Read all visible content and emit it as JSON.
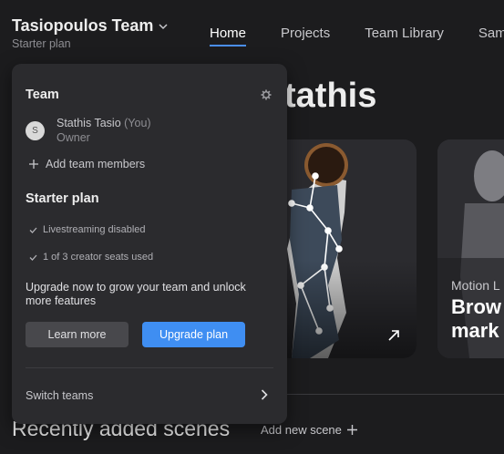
{
  "header": {
    "team_name": "Tasiopoulos Team",
    "plan_label": "Starter plan"
  },
  "nav": {
    "tabs": [
      {
        "label": "Home",
        "active": true
      },
      {
        "label": "Projects"
      },
      {
        "label": "Team Library"
      },
      {
        "label": "Sam"
      }
    ]
  },
  "background": {
    "greeting": "tathis",
    "card2_caption": "Motion L",
    "card2_title_line1": "Brow",
    "card2_title_line2": "mark",
    "recent_title": "Recently added scenes",
    "add_scene_label": "Add new scene"
  },
  "panel": {
    "team_heading": "Team",
    "member": {
      "initial": "S",
      "name": "Stathis Tasio",
      "you": "(You)",
      "role": "Owner"
    },
    "add_members_label": "Add team members",
    "plan_heading": "Starter plan",
    "features": [
      "Livestreaming disabled",
      "1 of 3 creator seats used"
    ],
    "upgrade_text": "Upgrade now to grow your team and unlock more features",
    "learn_more_label": "Learn more",
    "upgrade_plan_label": "Upgrade plan",
    "switch_teams_label": "Switch teams"
  },
  "colors": {
    "accent": "#3f8ef2",
    "background": "#1c1c1e",
    "panel": "#2b2b2e"
  }
}
